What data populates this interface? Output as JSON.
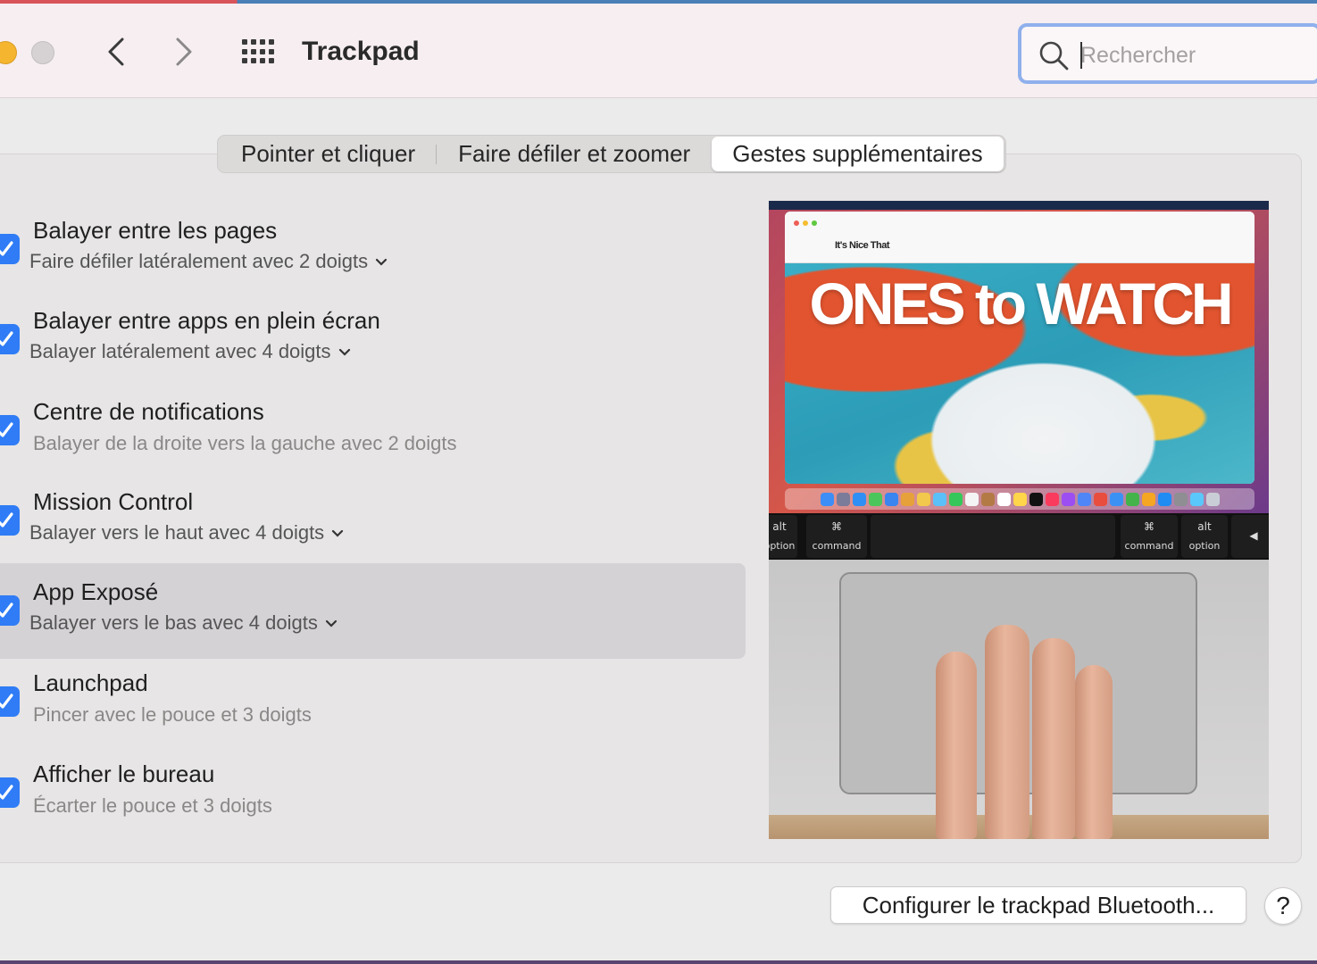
{
  "window": {
    "title": "Trackpad",
    "search_placeholder": "Rechercher"
  },
  "tabs": [
    {
      "label": "Pointer et cliquer",
      "active": false
    },
    {
      "label": "Faire défiler et zoomer",
      "active": false
    },
    {
      "label": "Gestes supplémentaires",
      "active": true
    }
  ],
  "gestures": [
    {
      "title": "Balayer entre les pages",
      "subtitle": "Faire défiler latéralement avec 2 doigts",
      "checked": true,
      "has_dropdown": true
    },
    {
      "title": "Balayer entre apps en plein écran",
      "subtitle": "Balayer latéralement avec 4 doigts",
      "checked": true,
      "has_dropdown": true
    },
    {
      "title": "Centre de notifications",
      "subtitle": "Balayer de la droite vers la gauche avec 2 doigts",
      "checked": true,
      "has_dropdown": false
    },
    {
      "title": "Mission Control",
      "subtitle": "Balayer vers le haut avec 4 doigts",
      "checked": true,
      "has_dropdown": true
    },
    {
      "title": "App Exposé",
      "subtitle": "Balayer vers le bas avec 4 doigts",
      "checked": true,
      "has_dropdown": true,
      "selected": true
    },
    {
      "title": "Launchpad",
      "subtitle": "Pincer avec le pouce et 3 doigts",
      "checked": true,
      "has_dropdown": false
    },
    {
      "title": "Afficher le bureau",
      "subtitle": "Écarter le pouce et 3 doigts",
      "checked": true,
      "has_dropdown": false
    }
  ],
  "preview": {
    "site_name": "It's Nice That",
    "hero_text": "ONES to WATCH",
    "keys": [
      {
        "symbol": "alt",
        "label": "option"
      },
      {
        "symbol": "⌘",
        "label": "command"
      },
      {
        "symbol": "⌘",
        "label": "command"
      },
      {
        "symbol": "alt",
        "label": "option"
      },
      {
        "symbol": "◀",
        "label": ""
      }
    ]
  },
  "buttons": {
    "configure": "Configurer le trackpad Bluetooth...",
    "help": "?"
  },
  "colors": {
    "accent": "#2f7cf6",
    "search_focus": "#8fb0ec",
    "selected_row": "#d5d2d6"
  }
}
